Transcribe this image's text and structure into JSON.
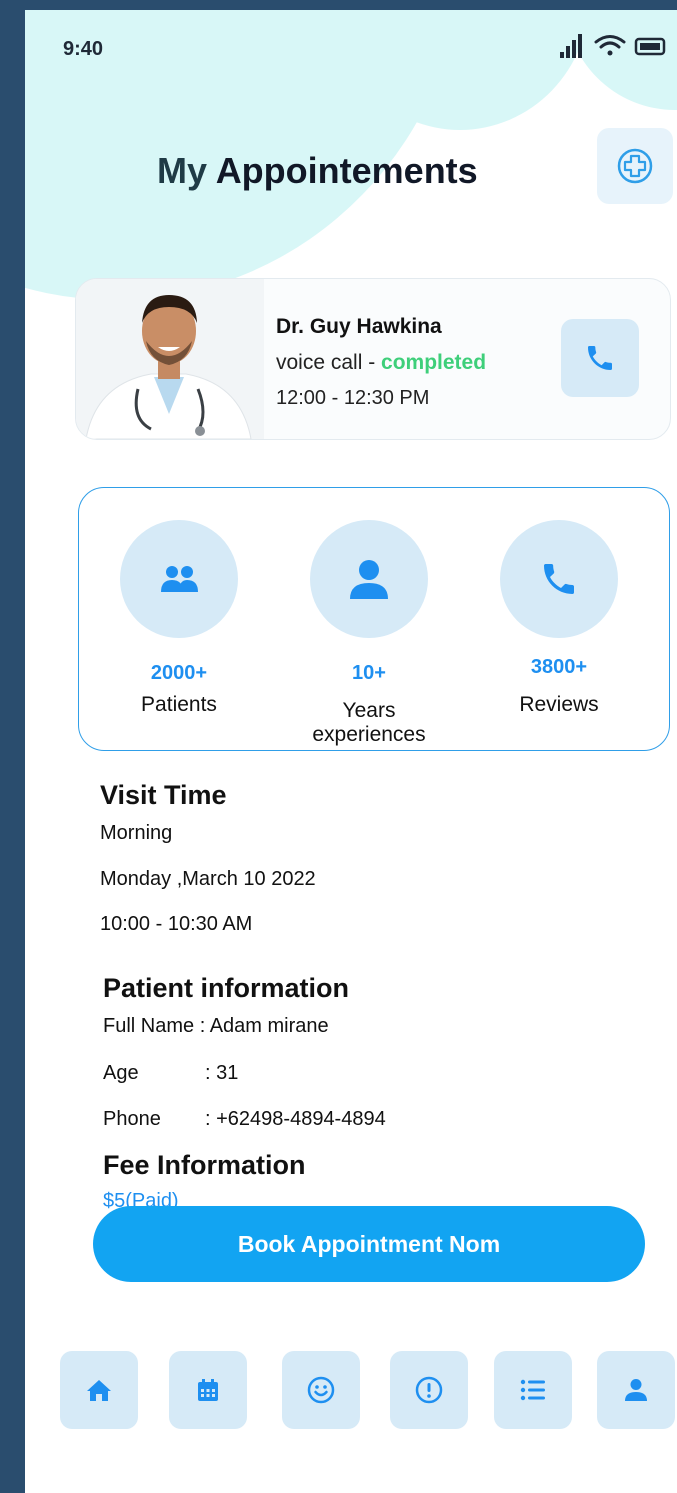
{
  "status_bar": {
    "time": "9:40"
  },
  "header": {
    "title_my": "My",
    "title_rest": "Appointements"
  },
  "doctor": {
    "name": "Dr. Guy Hawkina",
    "call_type": "voice call - ",
    "status": "completed",
    "time": "12:00 - 12:30 PM"
  },
  "stats": [
    {
      "value": "2000+",
      "label": "Patients",
      "icon": "patients-icon"
    },
    {
      "value": "10+",
      "label": "Years experiences",
      "icon": "user-icon"
    },
    {
      "value": "3800+",
      "label": "Reviews",
      "icon": "phone-icon"
    }
  ],
  "visit": {
    "title": "Visit Time",
    "period": "Morning",
    "date": "Monday ,March 10 2022",
    "time": "10:00 - 10:30 AM"
  },
  "patient": {
    "title": "Patient information",
    "name_line": "Full Name : Adam mirane",
    "age_label": "Age",
    "age_value": ":  31",
    "phone_label": "Phone",
    "phone_value": ": +62498-4894-4894"
  },
  "fee": {
    "title": "Fee  Information",
    "value": "$5(Paid)"
  },
  "cta": {
    "label": "Book Appointment Nom"
  },
  "colors": {
    "accent": "#12a4f2",
    "success": "#3ecf7a",
    "tile": "#d6eaf7",
    "blob": "#d8f7f7"
  },
  "nav": [
    "home-icon",
    "calendar-icon",
    "smile-icon",
    "alert-icon",
    "list-icon",
    "profile-icon"
  ]
}
